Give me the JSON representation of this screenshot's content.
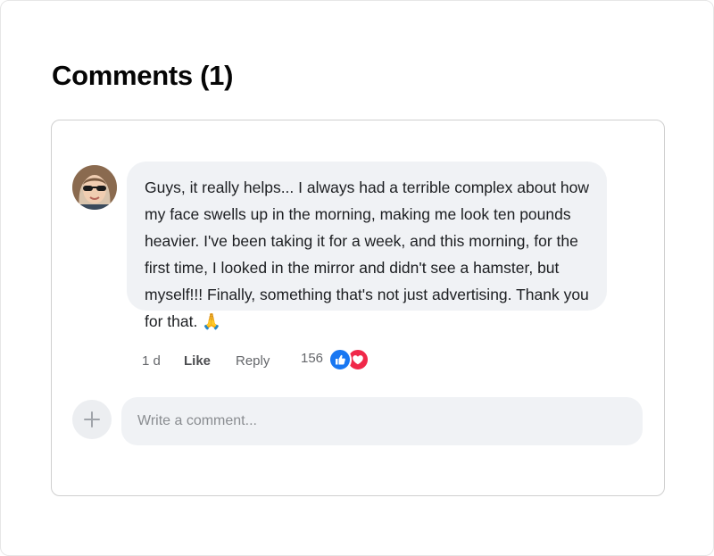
{
  "comments_header": {
    "title": "Comments (1)"
  },
  "comment": {
    "text": "Guys, it really helps... I always had a terrible complex about how my face swells up in the morning, making me look ten pounds heavier. I've been taking it for a week, and this morning, for the first time, I looked in the mirror and didn't see a hamster, but myself!!! Finally, something that's not just advertising. Thank you for that. 🙏",
    "time": "1 d",
    "like_label": "Like",
    "reply_label": "Reply",
    "reaction_count": "156",
    "reactions": [
      "like-icon",
      "love-icon"
    ]
  },
  "composer": {
    "placeholder": "Write a comment...",
    "add_icon": "plus-icon"
  },
  "colors": {
    "like": "#1877f2",
    "love": "#f02849",
    "bubble": "#f0f2f5"
  }
}
